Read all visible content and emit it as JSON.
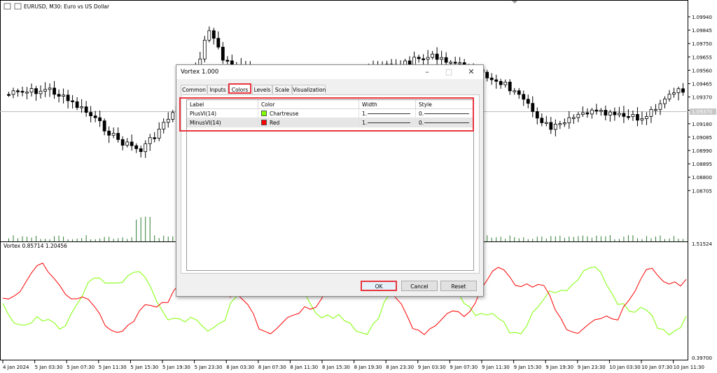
{
  "window": {
    "symbol_label": "EURUSD, M30:  Euro vs US Dollar",
    "indicator_label": "Vortex 0.85714 1.20456"
  },
  "price_axis": [
    "1.09940",
    "1.09845",
    "1.09750",
    "1.09655",
    "1.09560",
    "1.09465",
    "1.09370",
    "1.09275",
    "1.09180",
    "1.09085",
    "1.08990",
    "1.08895",
    "1.08800",
    "1.08705"
  ],
  "current_price_label": "1.09370",
  "indicator_axis": {
    "top": "1.51524",
    "bottom": "0.39700"
  },
  "time_axis": [
    "4 Jan 2024",
    "5 Jan 03:30",
    "5 Jan 07:30",
    "5 Jan 11:30",
    "5 Jan 15:30",
    "5 Jan 19:30",
    "5 Jan 23:30",
    "8 Jan 03:30",
    "8 Jan 07:30",
    "8 Jan 11:30",
    "8 Jan 15:30",
    "8 Jan 19:30",
    "8 Jan 23:30",
    "9 Jan 03:30",
    "9 Jan 07:30",
    "9 Jan 11:30",
    "9 Jan 15:30",
    "9 Jan 19:30",
    "9 Jan 23:30",
    "10 Jan 03:30",
    "10 Jan 07:30",
    "10 Jan 11:30"
  ],
  "colors": {
    "plus_vi": "#7fff00",
    "minus_vi": "#ff0000",
    "highlight": "#e8363f",
    "volume": "#2e7d32"
  },
  "dialog": {
    "title": "Vortex 1.000",
    "tabs": [
      {
        "label": "Common",
        "active": false
      },
      {
        "label": "Inputs",
        "active": false
      },
      {
        "label": "Colors",
        "active": true
      },
      {
        "label": "Levels",
        "active": false
      },
      {
        "label": "Scale",
        "active": false
      },
      {
        "label": "Visualization",
        "active": false
      }
    ],
    "columns": [
      "Label",
      "Color",
      "Width",
      "Style"
    ],
    "rows": [
      {
        "label": "PlusVI(14)",
        "color_name": "Chartreuse",
        "color": "#7fff00",
        "width": "1.",
        "style": "0."
      },
      {
        "label": "MinusVI(14)",
        "color_name": "Red",
        "color": "#ff0000",
        "width": "1.",
        "style": "0."
      }
    ],
    "buttons": {
      "ok": "OK",
      "cancel": "Cancel",
      "reset": "Reset"
    }
  }
}
